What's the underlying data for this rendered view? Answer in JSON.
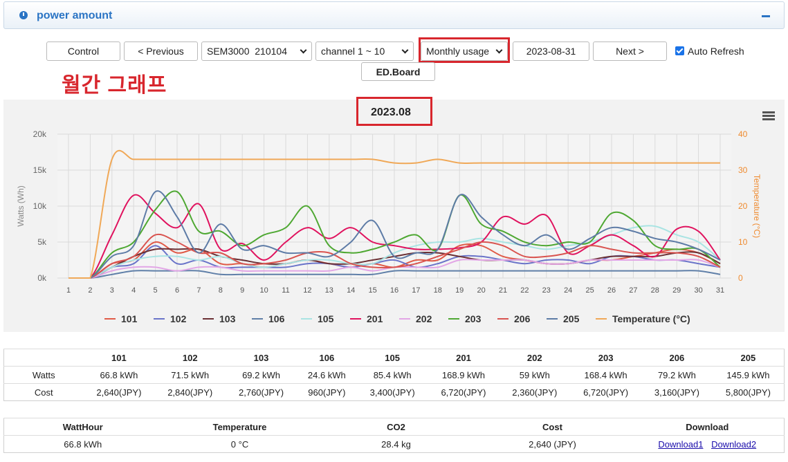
{
  "panel": {
    "title": "power amount"
  },
  "toolbar": {
    "control": "Control",
    "previous": "< Previous",
    "device": "SEM3000  210104",
    "channel": "channel 1 ~ 10",
    "mode": "Monthly usage",
    "date": "2023-08-31",
    "next": "Next >",
    "auto_refresh": "Auto Refresh",
    "edboard": "ED.Board"
  },
  "annotation": "월간 그래프",
  "colors": {
    "accent": "#2a74c4",
    "highlight": "#d8262d",
    "series": [
      "#e05a47",
      "#6a74c9",
      "#6b3034",
      "#5f7fa8",
      "#a9e4e3",
      "#e0125e",
      "#e2a6e6",
      "#4ea832",
      "#d9534f",
      "#5d7ba6"
    ],
    "temperature": "#f0a857"
  },
  "chart_data": {
    "type": "line",
    "title": "2023.08",
    "x": [
      1,
      2,
      3,
      4,
      5,
      6,
      7,
      8,
      9,
      10,
      11,
      12,
      13,
      14,
      15,
      16,
      17,
      18,
      19,
      20,
      21,
      22,
      23,
      24,
      25,
      26,
      27,
      28,
      29,
      30,
      31
    ],
    "ylabel": "Watts (Wh)",
    "y2label": "Temperature (°C)",
    "ylim": [
      0,
      20000
    ],
    "y2lim": [
      0,
      40
    ],
    "yticks": [
      "0k",
      "5k",
      "10k",
      "15k",
      "20k"
    ],
    "y2ticks": [
      "0",
      "10",
      "20",
      "30",
      "40"
    ],
    "grid": true,
    "legend_position": "bottom",
    "series": [
      {
        "name": "101",
        "values": [
          0,
          0,
          2000,
          2500,
          5000,
          3500,
          4000,
          2000,
          2000,
          1500,
          2000,
          2500,
          2000,
          1500,
          2000,
          1500,
          2500,
          2500,
          4500,
          4500,
          3000,
          2500,
          2000,
          2000,
          2500,
          2500,
          3000,
          3500,
          4000,
          3500,
          2000
        ]
      },
      {
        "name": "102",
        "values": [
          0,
          0,
          1500,
          2000,
          4500,
          2000,
          2500,
          1500,
          1500,
          1500,
          1500,
          2000,
          2000,
          1500,
          2000,
          2500,
          1500,
          2000,
          3000,
          3000,
          2500,
          2000,
          2500,
          2500,
          2000,
          3000,
          3000,
          2500,
          2500,
          2000,
          1500
        ]
      },
      {
        "name": "103",
        "values": [
          0,
          0,
          1500,
          3000,
          4000,
          4000,
          4000,
          3000,
          2500,
          2000,
          2000,
          2500,
          2000,
          2000,
          2500,
          3000,
          3500,
          3500,
          3000,
          2500,
          2500,
          2500,
          2000,
          2000,
          2500,
          3000,
          3000,
          3000,
          3500,
          3500,
          2000
        ]
      },
      {
        "name": "106",
        "values": [
          0,
          0,
          500,
          1000,
          1000,
          1000,
          1000,
          500,
          500,
          500,
          500,
          500,
          500,
          500,
          500,
          1000,
          1000,
          1000,
          1000,
          1000,
          1000,
          1000,
          1000,
          1000,
          1000,
          1000,
          1000,
          1000,
          1000,
          1000,
          500
        ]
      },
      {
        "name": "105",
        "values": [
          0,
          0,
          1500,
          2500,
          3000,
          3000,
          2500,
          3000,
          2000,
          1500,
          2000,
          2500,
          2500,
          2000,
          2000,
          3500,
          4500,
          5000,
          5000,
          5500,
          5000,
          4500,
          4000,
          4500,
          5000,
          6000,
          7000,
          7200,
          6000,
          5000,
          2500
        ]
      },
      {
        "name": "201",
        "values": [
          0,
          0,
          6000,
          11500,
          9000,
          7000,
          10300,
          4000,
          4800,
          2500,
          5000,
          7000,
          5500,
          7000,
          5000,
          4500,
          4000,
          4000,
          4200,
          5000,
          8500,
          7500,
          8700,
          3500,
          4500,
          6000,
          4500,
          3000,
          6800,
          6500,
          2500
        ]
      },
      {
        "name": "202",
        "values": [
          0,
          0,
          1000,
          1500,
          1500,
          1000,
          1500,
          1500,
          1000,
          1000,
          1000,
          1000,
          1000,
          1500,
          1000,
          1500,
          1500,
          1500,
          2500,
          2500,
          2500,
          2500,
          2000,
          2000,
          2500,
          2500,
          2500,
          2500,
          2500,
          2500,
          1500
        ]
      },
      {
        "name": "203",
        "values": [
          0,
          0,
          3500,
          5000,
          9500,
          12000,
          6500,
          6500,
          4500,
          6000,
          7000,
          10000,
          4500,
          3500,
          4000,
          5000,
          6000,
          4000,
          11500,
          7500,
          6500,
          5000,
          4500,
          5000,
          5000,
          9000,
          8000,
          4500,
          4000,
          4000,
          1500
        ]
      },
      {
        "name": "206",
        "values": [
          0,
          0,
          2000,
          3000,
          6000,
          5000,
          3500,
          3500,
          2000,
          2000,
          2500,
          3500,
          3500,
          2000,
          1500,
          1500,
          2000,
          3000,
          4000,
          5000,
          4500,
          3000,
          3000,
          3500,
          4500,
          4000,
          3500,
          3500,
          3500,
          3000,
          1500
        ]
      },
      {
        "name": "205",
        "values": [
          0,
          0,
          3000,
          4500,
          12000,
          8500,
          3500,
          7500,
          4000,
          4500,
          3500,
          3500,
          3000,
          5000,
          8000,
          3000,
          3500,
          4000,
          11500,
          8500,
          6000,
          4500,
          6000,
          4000,
          5500,
          7000,
          6500,
          5500,
          5000,
          4000,
          2500
        ]
      }
    ],
    "temperature": {
      "name": "Temperature (°C)",
      "values": [
        0,
        0,
        33,
        33,
        33,
        33,
        33,
        33,
        33,
        33,
        33,
        33,
        33,
        33,
        33,
        32,
        32,
        33,
        32,
        32,
        32,
        32,
        32,
        32,
        32,
        32,
        32,
        32,
        32,
        32,
        32
      ]
    }
  },
  "summary": {
    "columns": [
      "101",
      "102",
      "103",
      "106",
      "105",
      "201",
      "202",
      "203",
      "206",
      "205"
    ],
    "rows": [
      {
        "label": "Watts",
        "cells": [
          "66.8 kWh",
          "71.5 kWh",
          "69.2 kWh",
          "24.6 kWh",
          "85.4 kWh",
          "168.9 kWh",
          "59 kWh",
          "168.4 kWh",
          "79.2 kWh",
          "145.9 kWh"
        ]
      },
      {
        "label": "Cost",
        "cells": [
          "2,640(JPY)",
          "2,840(JPY)",
          "2,760(JPY)",
          "960(JPY)",
          "3,400(JPY)",
          "6,720(JPY)",
          "2,360(JPY)",
          "6,720(JPY)",
          "3,160(JPY)",
          "5,800(JPY)"
        ]
      }
    ]
  },
  "totals": {
    "headers": [
      "WattHour",
      "Temperature",
      "CO2",
      "Cost",
      "Download"
    ],
    "watthour": "66.8 kWh",
    "temperature": "0 °C",
    "co2": "28.4 kg",
    "cost": "2,640 (JPY)",
    "download1": "Download1",
    "download2": "Download2"
  }
}
